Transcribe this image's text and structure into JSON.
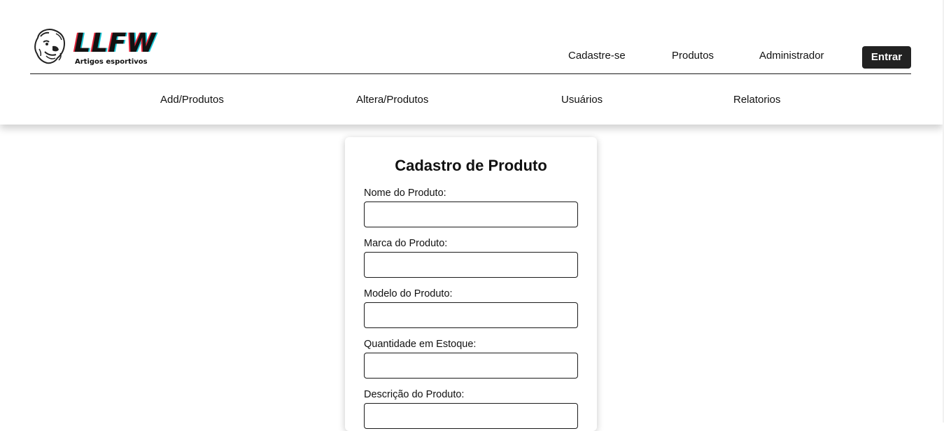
{
  "brand": {
    "name": "LLFW",
    "tagline": "Artigos esportivos",
    "mascot_icon": "lion-head-icon",
    "accent_red": "#e0263a",
    "accent_cyan": "#19c6d6"
  },
  "top_nav": {
    "items": [
      {
        "label": "Cadastre-se"
      },
      {
        "label": "Produtos"
      },
      {
        "label": "Administrador"
      }
    ],
    "login_button": "Entrar"
  },
  "admin_nav": {
    "items": [
      {
        "label": "Add/Produtos"
      },
      {
        "label": "Altera/Produtos"
      },
      {
        "label": "Usuários"
      },
      {
        "label": "Relatorios"
      }
    ]
  },
  "form": {
    "title": "Cadastro de Produto",
    "fields": [
      {
        "label": "Nome do Produto:",
        "value": ""
      },
      {
        "label": "Marca do Produto:",
        "value": ""
      },
      {
        "label": "Modelo do Produto:",
        "value": ""
      },
      {
        "label": "Quantidade em Estoque:",
        "value": ""
      },
      {
        "label": "Descrição do Produto:",
        "value": ""
      }
    ]
  },
  "colors": {
    "button_bg": "#222222",
    "button_text": "#ffffff",
    "text": "#111111"
  }
}
